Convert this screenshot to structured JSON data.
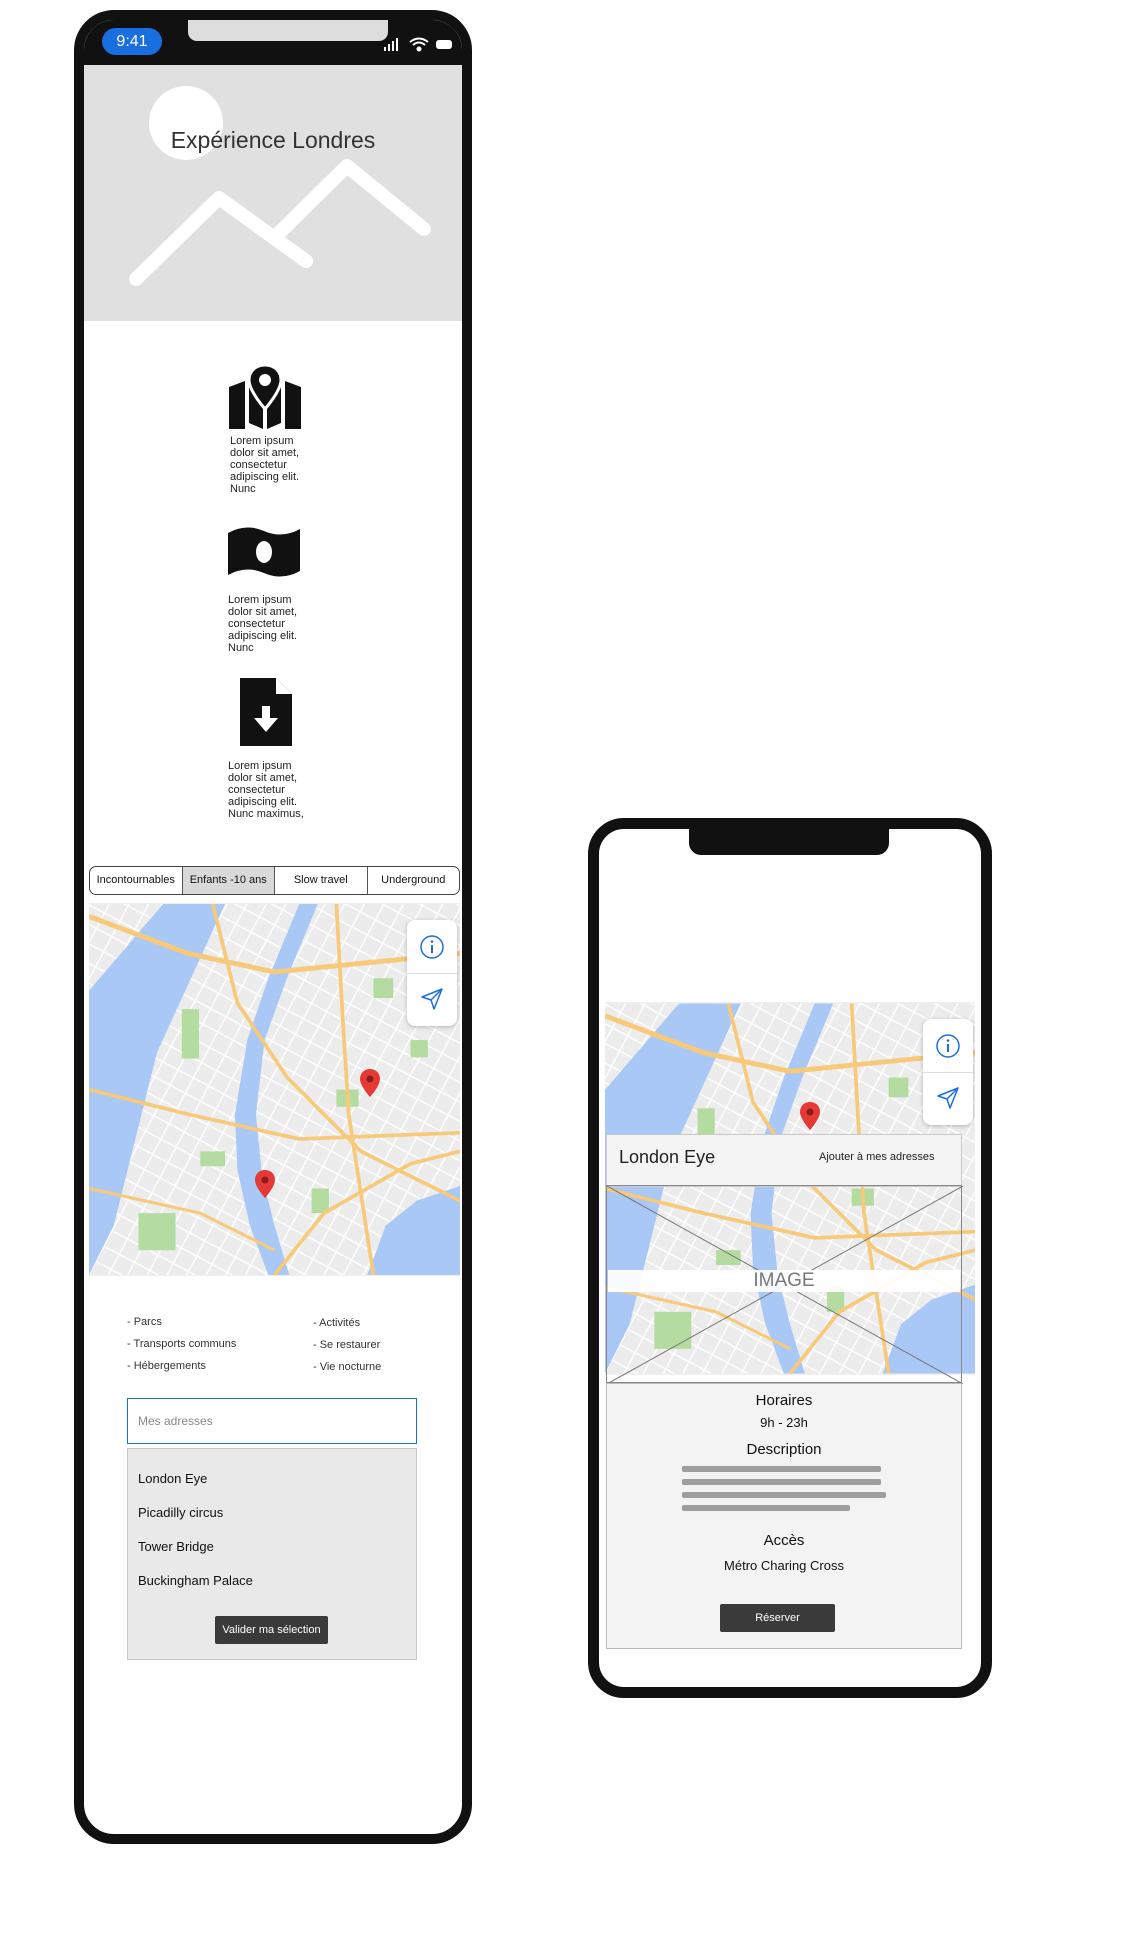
{
  "phone1": {
    "status_time": "9:41",
    "hero_title": "Expérience Londres",
    "features": [
      {
        "icon": "map-pin-icon",
        "text": "Lorem ipsum dolor sit amet, consectetur adipiscing elit. Nunc"
      },
      {
        "icon": "money-bill-icon",
        "text": "Lorem ipsum dolor sit amet, consectetur adipiscing elit. Nunc"
      },
      {
        "icon": "file-download-icon",
        "text": "Lorem ipsum dolor sit amet, consectetur adipiscing elit. Nunc maximus,"
      }
    ],
    "tabs": [
      {
        "label": "Incontournables",
        "active": false
      },
      {
        "label": "Enfants -10 ans",
        "active": true
      },
      {
        "label": "Slow travel",
        "active": false
      },
      {
        "label": "Underground",
        "active": false
      }
    ],
    "categories_left": [
      "- Parcs",
      "- Transports communs",
      "- Hébergements"
    ],
    "categories_right": [
      "- Activités",
      "- Se restaurer",
      "- Vie nocturne"
    ],
    "address_input_placeholder": "Mes adresses",
    "addresses": [
      "London Eye",
      "Picadilly circus",
      "Tower Bridge",
      "Buckingham Palace"
    ],
    "validate_label": "Valider ma sélection"
  },
  "phone2": {
    "place_name": "London Eye",
    "add_link": "Ajouter à mes adresses",
    "image_placeholder": "IMAGE",
    "hours_title": "Horaires",
    "hours_value": "9h - 23h",
    "description_title": "Description",
    "access_title": "Accès",
    "access_value": "Métro Charing Cross",
    "book_label": "Réserver"
  },
  "colors": {
    "accent_blue": "#1a6fe0",
    "map_pin_red": "#e53935",
    "water": "#a9c8f5",
    "park": "#b5dca0",
    "road": "#f7c97a",
    "button_dark": "#3a3a3a"
  }
}
